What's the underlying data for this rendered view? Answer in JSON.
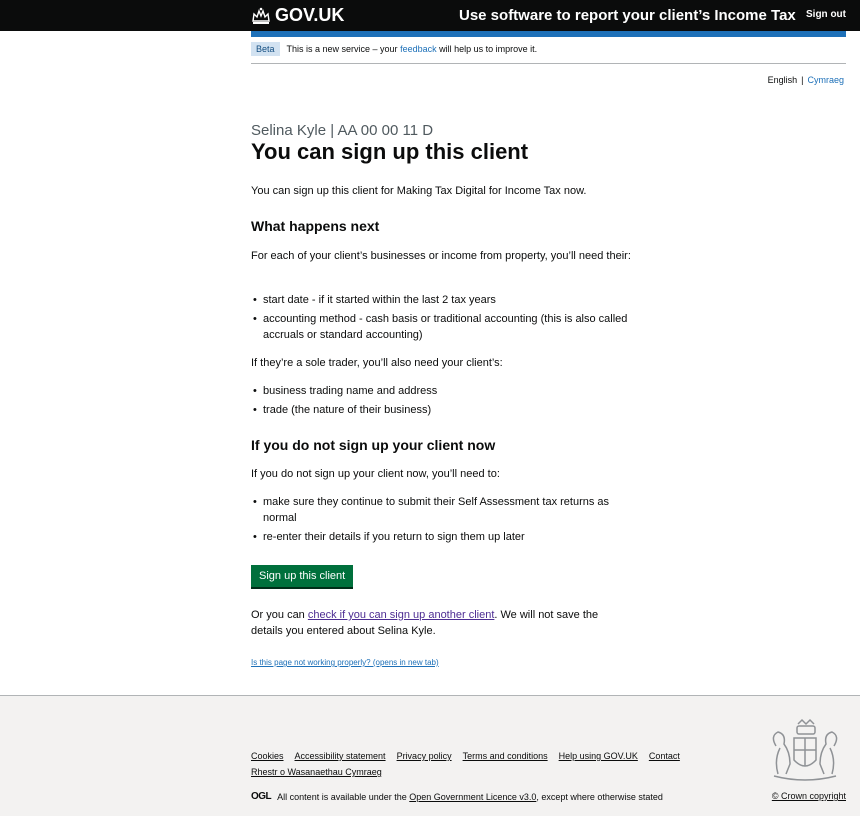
{
  "header": {
    "logo_text": "GOV.UK",
    "service_name": "Use software to report your client’s Income Tax",
    "signout_label": "Sign out"
  },
  "phase_banner": {
    "tag": "Beta",
    "text_before": "This is a new service – your",
    "link": "feedback",
    "text_after": "will help us to improve it."
  },
  "language": {
    "current": "English",
    "separator": "|",
    "other": "Cymraeg"
  },
  "main": {
    "caption": "Selina Kyle | AA 00 00 11 D",
    "title": "You can sign up this client",
    "intro": "You can sign up this client for Making Tax Digital for Income Tax now.",
    "what_next_heading": "What happens next",
    "what_next_text": "For each of your client’s businesses or income from property, you’ll need their:",
    "what_next_items": [
      "start date - if it started within the last 2 tax years",
      "accounting method - cash basis or traditional accounting (this is also called accruals or standard accounting)"
    ],
    "sole_trader_text": "If they’re a sole trader, you’ll also need your client’s:",
    "sole_trader_items": [
      "business trading name and address",
      "trade (the nature of their business)"
    ],
    "not_now_heading": "If you do not sign up your client now",
    "not_now_text": "If you do not sign up your client now, you’ll need to:",
    "not_now_items": [
      "make sure they continue to submit their Self Assessment tax returns as normal",
      "re-enter their details if you return to sign them up later"
    ],
    "button_label": "Sign up this client",
    "or_text_before": "Or you can",
    "or_link": "check if you can sign up another client",
    "or_text_after": ". We will not save the details you entered about Selina Kyle.",
    "problem_link": "Is this page not working properly? (opens in new tab)"
  },
  "footer": {
    "links": [
      "Cookies",
      "Accessibility statement",
      "Privacy policy",
      "Terms and conditions",
      "Help using GOV.UK",
      "Contact"
    ],
    "welsh_link": "Rhestr o Wasanaethau Cymraeg",
    "ogl_logo": "OGL",
    "licence_before": "All content is available under the",
    "licence_link": "Open Government Licence v3.0",
    "licence_after": ", except where otherwise stated",
    "crown_copyright": "© Crown copyright"
  }
}
